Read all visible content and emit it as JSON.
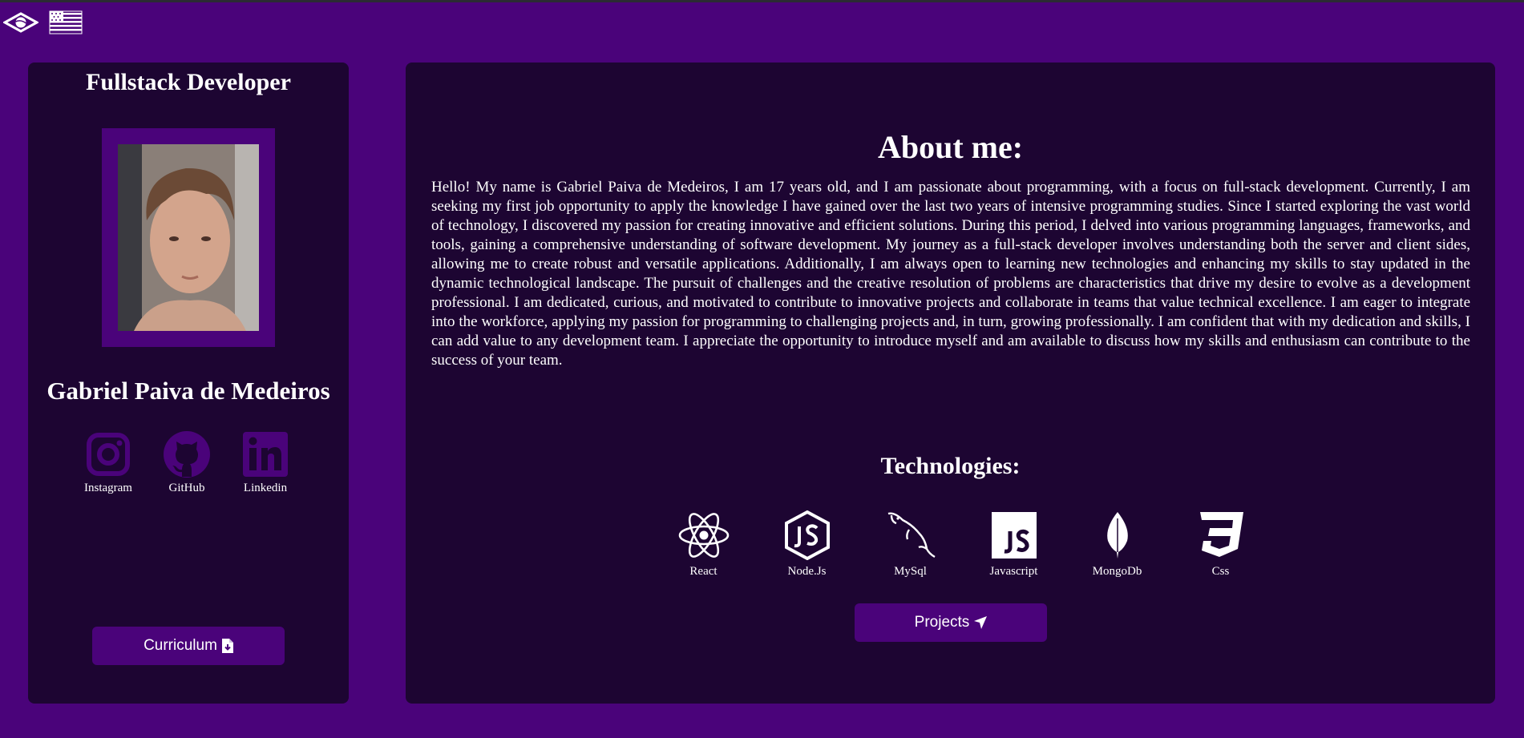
{
  "languages": [
    {
      "icon": "brazil-flag-icon"
    },
    {
      "icon": "usa-flag-icon"
    }
  ],
  "profile": {
    "role_title": "Fullstack Developer",
    "name": "Gabriel Paiva de Medeiros",
    "curriculum_label": "Curriculum",
    "socials": [
      {
        "label": "Instagram",
        "icon": "instagram-icon"
      },
      {
        "label": "GitHub",
        "icon": "github-icon"
      },
      {
        "label": "Linkedin",
        "icon": "linkedin-icon"
      }
    ]
  },
  "about": {
    "title": "About me:",
    "text": "Hello! My name is Gabriel Paiva de Medeiros, I am 17 years old, and I am passionate about programming, with a focus on full-stack development. Currently, I am seeking my first job opportunity to apply the knowledge I have gained over the last two years of intensive programming studies. Since I started exploring the vast world of technology, I discovered my passion for creating innovative and efficient solutions. During this period, I delved into various programming languages, frameworks, and tools, gaining a comprehensive understanding of software development. My journey as a full-stack developer involves understanding both the server and client sides, allowing me to create robust and versatile applications. Additionally, I am always open to learning new technologies and enhancing my skills to stay updated in the dynamic technological landscape. The pursuit of challenges and the creative resolution of problems are characteristics that drive my desire to evolve as a development professional. I am dedicated, curious, and motivated to contribute to innovative projects and collaborate in teams that value technical excellence. I am eager to integrate into the workforce, applying my passion for programming to challenging projects and, in turn, growing professionally. I am confident that with my dedication and skills, I can add value to any development team. I appreciate the opportunity to introduce myself and am available to discuss how my skills and enthusiasm can contribute to the success of your team."
  },
  "technologies": {
    "title": "Technologies:",
    "items": [
      {
        "label": "React",
        "icon": "react-icon"
      },
      {
        "label": "Node.Js",
        "icon": "nodejs-icon"
      },
      {
        "label": "MySql",
        "icon": "mysql-dolphin-icon"
      },
      {
        "label": "Javascript",
        "icon": "javascript-icon"
      },
      {
        "label": "MongoDb",
        "icon": "mongodb-leaf-icon"
      },
      {
        "label": "Css",
        "icon": "css3-icon"
      }
    ]
  },
  "projects_label": "Projects",
  "colors": {
    "background": "#4a037a",
    "card": "#1d0532",
    "accent": "#4a037a",
    "text": "#ffffff"
  }
}
